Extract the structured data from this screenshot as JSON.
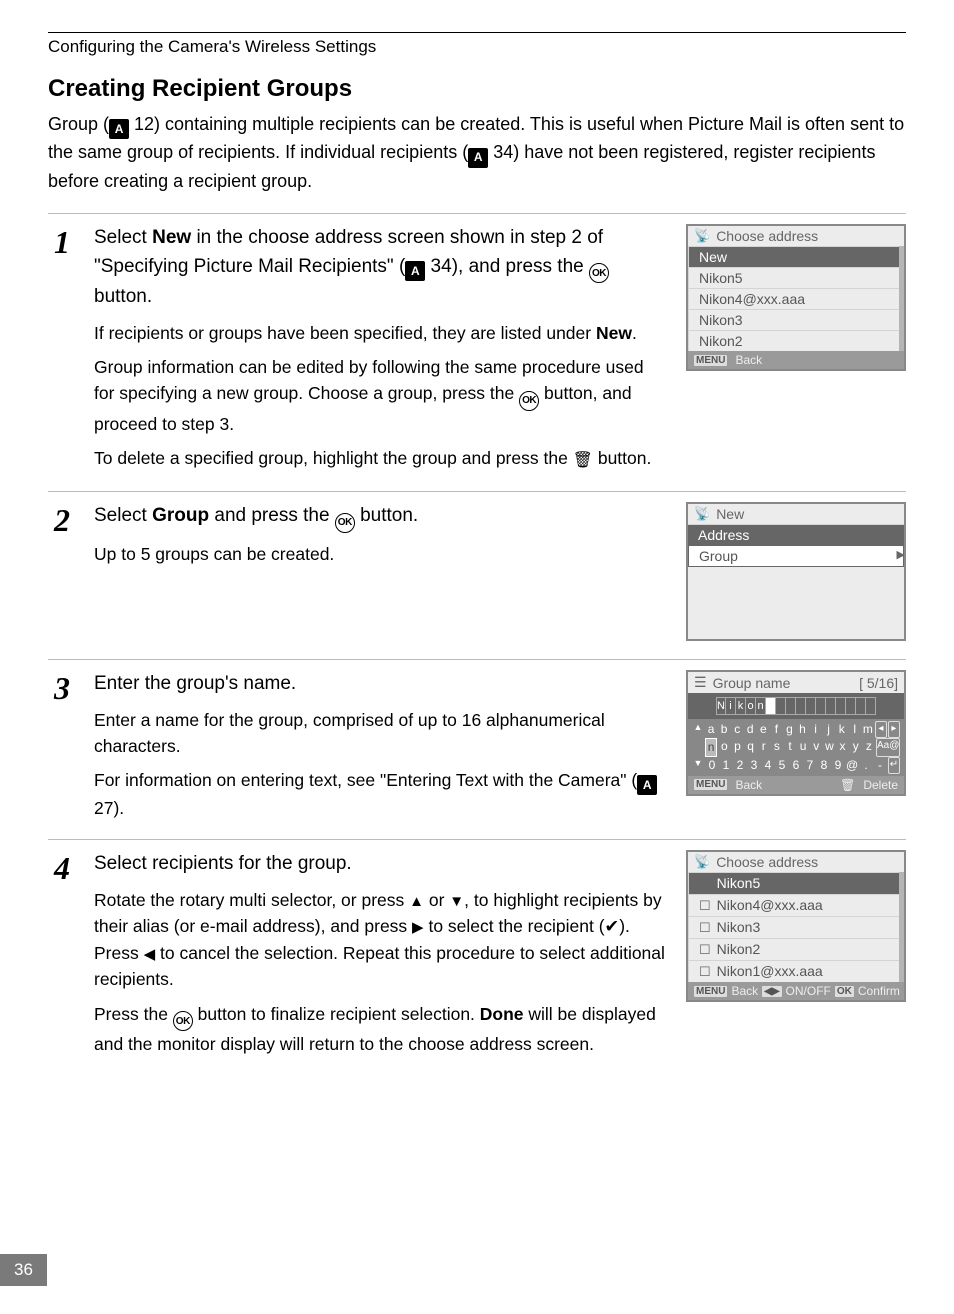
{
  "runningHead": "Configuring the Camera's Wireless Settings",
  "heading": "Creating Recipient Groups",
  "intro": {
    "seg1": "Group (",
    "ref1": " 12) containing multiple recipients can be created. This is useful when Picture Mail is often sent to the same group of recipients. If individual recipients (",
    "ref2": " 34) have not been registered, register recipients before creating a recipient group."
  },
  "steps": {
    "s1": {
      "num": "1",
      "title": {
        "a": "Select ",
        "b": "New",
        "c": " in the choose address screen shown in step 2 of \"Specifying Picture Mail Recipients\" (",
        "d": " 34), and press the ",
        "e": " button."
      },
      "p1": {
        "a": "If recipients or groups have been specified, they are listed under ",
        "b": "New",
        "c": "."
      },
      "p2": {
        "a": "Group information can be edited by following the same procedure used for specifying a new group. Choose a group, press the ",
        "b": " button, and proceed to step 3."
      },
      "p3": {
        "a": "To delete a specified group, highlight the group and press the ",
        "b": " button."
      }
    },
    "s2": {
      "num": "2",
      "title": {
        "a": "Select ",
        "b": "Group",
        "c": " and press the ",
        "d": " button."
      },
      "p1": "Up to 5 groups can be created."
    },
    "s3": {
      "num": "3",
      "title": "Enter the group's name.",
      "p1": "Enter a name for the group, comprised of up to 16 alphanumerical characters.",
      "p2": {
        "a": "For information on entering text, see \"Entering Text with the Camera\" (",
        "b": " 27)."
      }
    },
    "s4": {
      "num": "4",
      "title": "Select recipients for the group.",
      "p1": {
        "a": "Rotate the rotary multi selector, or press ",
        "up": "▲",
        "b": " or ",
        "down": "▼",
        "c": ", to highlight recipients by their alias (or e-mail address), and press ",
        "right": "▶",
        "d": " to select the recipient (",
        "check": "✔",
        "e": "). Press ",
        "left": "◀",
        "f": " to cancel the selection. Repeat this procedure to select additional recipients."
      },
      "p2": {
        "a": "Press the ",
        "b": " button to finalize recipient selection. ",
        "c": "Done",
        "d": " will be displayed and the monitor display will return to the choose address screen."
      }
    }
  },
  "screens": {
    "s1": {
      "title": "Choose address",
      "items": [
        "New",
        "Nikon5",
        "Nikon4@xxx.aaa",
        "Nikon3",
        "Nikon2"
      ],
      "softBack": "Back",
      "menuTag": "MENU"
    },
    "s2": {
      "title": "New",
      "items": [
        "Address",
        "Group"
      ]
    },
    "s3": {
      "title": "Group name",
      "counter": "[  5/16]",
      "entered": [
        "N",
        "i",
        "k",
        "o",
        "n"
      ],
      "kbd": {
        "r1": [
          "a",
          "b",
          "c",
          "d",
          "e",
          "f",
          "g",
          "h",
          "i",
          "j",
          "k",
          "l",
          "m",
          "◂",
          "▸"
        ],
        "r2": [
          "n",
          "o",
          "p",
          "q",
          "r",
          "s",
          "t",
          "u",
          "v",
          "w",
          "x",
          "y",
          "z",
          "Aa@"
        ],
        "r3": [
          "0",
          "1",
          "2",
          "3",
          "4",
          "5",
          "6",
          "7",
          "8",
          "9",
          "@",
          ".",
          "-",
          "↵"
        ]
      },
      "softBack": "Back",
      "softDelete": "Delete",
      "menuTag": "MENU"
    },
    "s4": {
      "title": "Choose address",
      "items": [
        {
          "label": "Nikon5",
          "checked": true
        },
        {
          "label": "Nikon4@xxx.aaa",
          "checked": false
        },
        {
          "label": "Nikon3",
          "checked": false
        },
        {
          "label": "Nikon2",
          "checked": false
        },
        {
          "label": "Nikon1@xxx.aaa",
          "checked": false
        }
      ],
      "softBack": "Back",
      "softOnOff": "ON/OFF",
      "softConfirm": "Confirm",
      "menuTag": "MENU",
      "okTag": "OK"
    }
  },
  "pageNumber": "36"
}
